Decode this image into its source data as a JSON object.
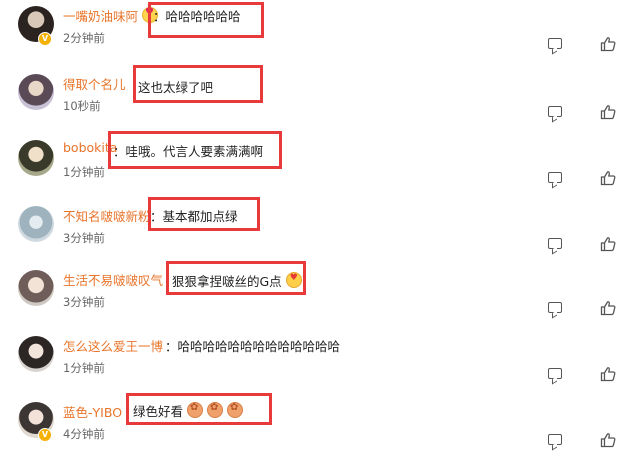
{
  "comments": [
    {
      "username": "一嘴奶油味阿",
      "text": "：哈哈哈哈哈哈",
      "time": "2分钟前",
      "verified": true,
      "name_emoji": "heart-eyes-emoji",
      "text_emojis": [],
      "highlight": true
    },
    {
      "username": "得取个名儿",
      "text": "这也太绿了吧",
      "time": "10秒前",
      "verified": false,
      "name_emoji": "",
      "text_emojis": [],
      "highlight": true
    },
    {
      "username": "bobokita",
      "text": "：哇哦。代言人要素满满啊",
      "time": "1分钟前",
      "verified": false,
      "name_emoji": "",
      "text_emojis": [],
      "highlight": true
    },
    {
      "username": "不知名啵啵新粉",
      "text": "：基本都加点绿",
      "time": "3分钟前",
      "verified": false,
      "name_emoji": "",
      "text_emojis": [],
      "highlight": true
    },
    {
      "username": "生活不易啵啵叹气",
      "text": "狠狠拿捏啵丝的G点",
      "time": "3分钟前",
      "verified": false,
      "name_emoji": "",
      "text_emojis": [
        "love-face-emoji"
      ],
      "highlight": true
    },
    {
      "username": "怎么这么爱王一博",
      "text": "：哈哈哈哈哈哈哈哈哈哈哈哈哈",
      "time": "1分钟前",
      "verified": false,
      "name_emoji": "",
      "text_emojis": [],
      "highlight": false
    },
    {
      "username": "蓝色-YIBO",
      "text": "绿色好看",
      "time": "4分钟前",
      "verified": true,
      "name_emoji": "",
      "text_emojis": [
        "cheer-emoji",
        "cheer-emoji",
        "cheer-emoji"
      ],
      "highlight": true
    }
  ],
  "icons": {
    "comment": "comment-icon",
    "like": "thumbs-up-icon"
  },
  "colors": {
    "username": "#e8742a",
    "highlight": "#e83a3a",
    "verified": "#f5b000"
  }
}
